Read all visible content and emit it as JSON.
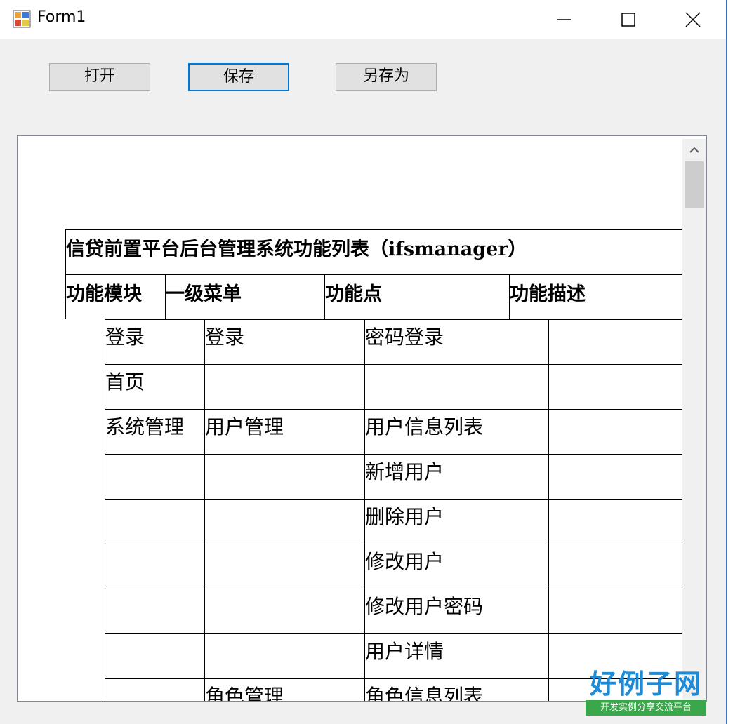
{
  "window": {
    "title": "Form1"
  },
  "toolbar": {
    "open_label": "打开",
    "save_label": "保存",
    "save_as_label": "另存为"
  },
  "document": {
    "title": "信贷前置平台后台管理系统功能列表（ifsmanager）",
    "headers": [
      "功能模块",
      "一级菜单",
      "功能点",
      "功能描述"
    ],
    "rows": [
      [
        "登录",
        "登录",
        "密码登录",
        ""
      ],
      [
        "首页",
        "",
        "",
        ""
      ],
      [
        "系统管理",
        "用户管理",
        "用户信息列表",
        ""
      ],
      [
        "",
        "",
        "新增用户",
        ""
      ],
      [
        "",
        "",
        "删除用户",
        ""
      ],
      [
        "",
        "",
        "修改用户",
        ""
      ],
      [
        "",
        "",
        "修改用户密码",
        ""
      ],
      [
        "",
        "",
        "用户详情",
        ""
      ],
      [
        "",
        "角色管理",
        "角色信息列表",
        ""
      ]
    ]
  },
  "watermark": {
    "logo_text": "好例子网",
    "tagline": "开发实例分享交流平台"
  },
  "colors": {
    "focus_border": "#0078d7",
    "logo_blue": "#1e8bd6",
    "logo_green": "#3aa84a"
  },
  "icons": [
    "app-icon",
    "minimize-icon",
    "maximize-icon",
    "close-icon",
    "scroll-up-arrow-icon"
  ]
}
